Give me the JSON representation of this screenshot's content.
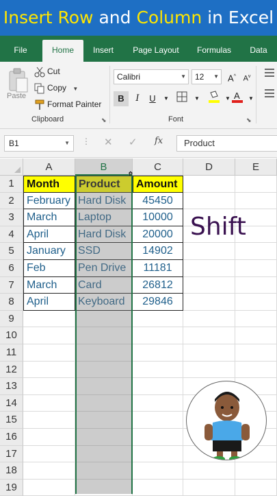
{
  "banner": {
    "part1": "Insert Row",
    "part2": "and",
    "part3": "Column",
    "part4": "in Excel"
  },
  "tabs": [
    "File",
    "Home",
    "Insert",
    "Page Layout",
    "Formulas",
    "Data"
  ],
  "ribbon": {
    "paste_label": "Paste",
    "cut_label": "Cut",
    "copy_label": "Copy",
    "format_painter_label": "Format Painter",
    "clipboard_group": "Clipboard",
    "font_name": "Calibri",
    "font_size": "12",
    "font_group": "Font",
    "bold": "B",
    "italic": "I",
    "underline": "U"
  },
  "formula_bar": {
    "name_box": "B1",
    "fx": "fx",
    "content": "Product"
  },
  "columns": [
    "A",
    "B",
    "C",
    "D",
    "E"
  ],
  "rows": [
    "1",
    "2",
    "3",
    "4",
    "5",
    "6",
    "7",
    "8",
    "9",
    "10",
    "11",
    "12",
    "13",
    "14",
    "15",
    "16",
    "17",
    "18",
    "19"
  ],
  "table": {
    "headers": [
      "Month",
      "Product",
      "Amount"
    ],
    "rows": [
      [
        "February",
        "Hard Disk",
        "45450"
      ],
      [
        "March",
        "Laptop",
        "10000"
      ],
      [
        "April",
        "Hard Disk",
        "20000"
      ],
      [
        "January",
        "SSD",
        "14902"
      ],
      [
        "Feb",
        "Pen Drive",
        "11181"
      ],
      [
        "March",
        "Card",
        "26812"
      ],
      [
        "April",
        "Keyboard",
        "29846"
      ]
    ]
  },
  "overlay": {
    "key_hint": "Shift"
  },
  "colors": {
    "excel_green": "#217346",
    "banner_blue": "#1e6fc4",
    "banner_highlight": "#ffe600",
    "header_fill": "#ffff00"
  }
}
